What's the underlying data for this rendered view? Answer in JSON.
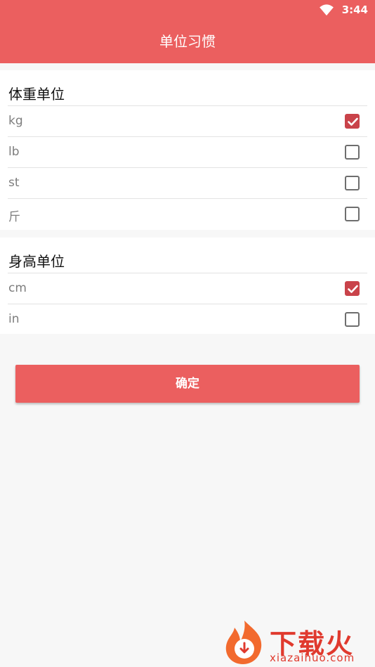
{
  "status_bar": {
    "time": "3:44",
    "wifi_icon": "wifi-icon"
  },
  "app_bar": {
    "title": "单位习惯"
  },
  "weight_section": {
    "title": "体重单位",
    "options": [
      {
        "label": "kg",
        "checked": true
      },
      {
        "label": "lb",
        "checked": false
      },
      {
        "label": "st",
        "checked": false
      },
      {
        "label": "斤",
        "checked": false
      }
    ]
  },
  "height_section": {
    "title": "身高单位",
    "options": [
      {
        "label": "cm",
        "checked": true
      },
      {
        "label": "in",
        "checked": false
      }
    ]
  },
  "confirm_button": {
    "label": "确定"
  },
  "watermark": {
    "brand": "下载火",
    "domain": "xiazaihuo.com"
  },
  "colors": {
    "primary": "#eb5f5f",
    "checkbox_checked": "#c9434a",
    "background": "#f7f7f7"
  }
}
